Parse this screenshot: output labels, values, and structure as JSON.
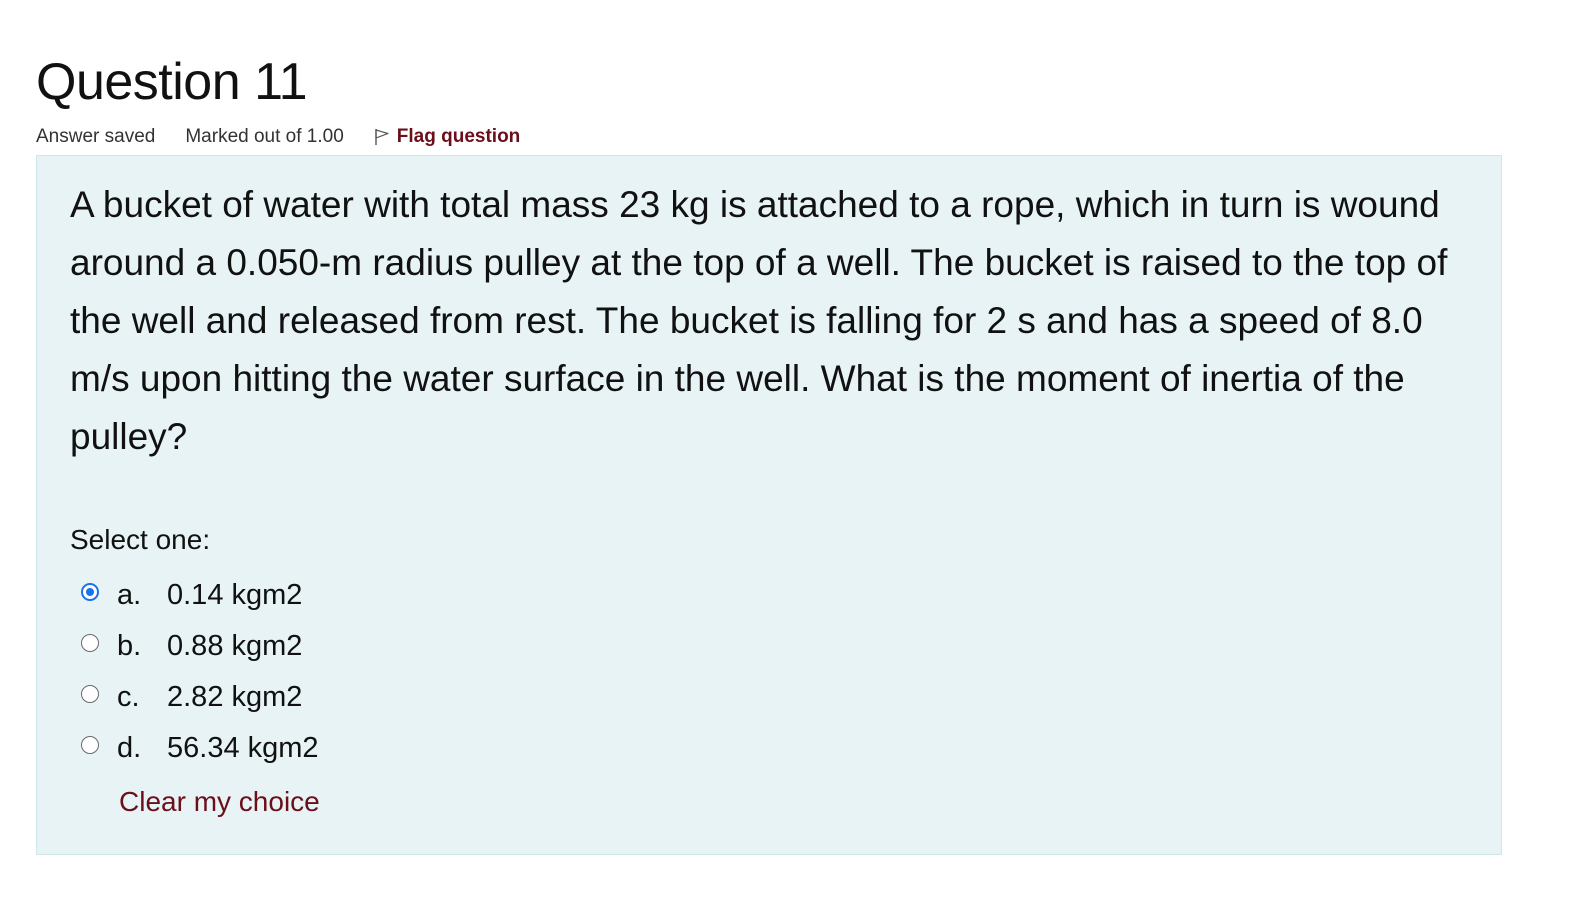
{
  "question": {
    "title": "Question 11",
    "state": "Answer saved",
    "grade": "Marked out of 1.00",
    "flag_label": "Flag question",
    "text": "A bucket of water with total mass 23 kg is attached to a rope, which in turn is wound around a 0.050-m radius pulley at the top of a well. The bucket is raised to the top of the well and released from rest. The bucket is falling for 2 s and has a speed of 8.0 m/s upon hitting the water surface in the well. What is the moment of inertia of the pulley?",
    "prompt": "Select one:",
    "options": [
      {
        "letter": "a.",
        "label": "0.14 kgm2",
        "selected": true
      },
      {
        "letter": "b.",
        "label": "0.88 kgm2",
        "selected": false
      },
      {
        "letter": "c.",
        "label": "2.82 kgm2",
        "selected": false
      },
      {
        "letter": "d.",
        "label": "56.34 kgm2",
        "selected": false
      }
    ],
    "clear_label": "Clear my choice"
  },
  "colors": {
    "formulation_bg": "#e7f3f5",
    "link": "#6b0f1a",
    "radio_selected": "#1a73e8"
  },
  "icons": {
    "flag": "flag-icon"
  }
}
